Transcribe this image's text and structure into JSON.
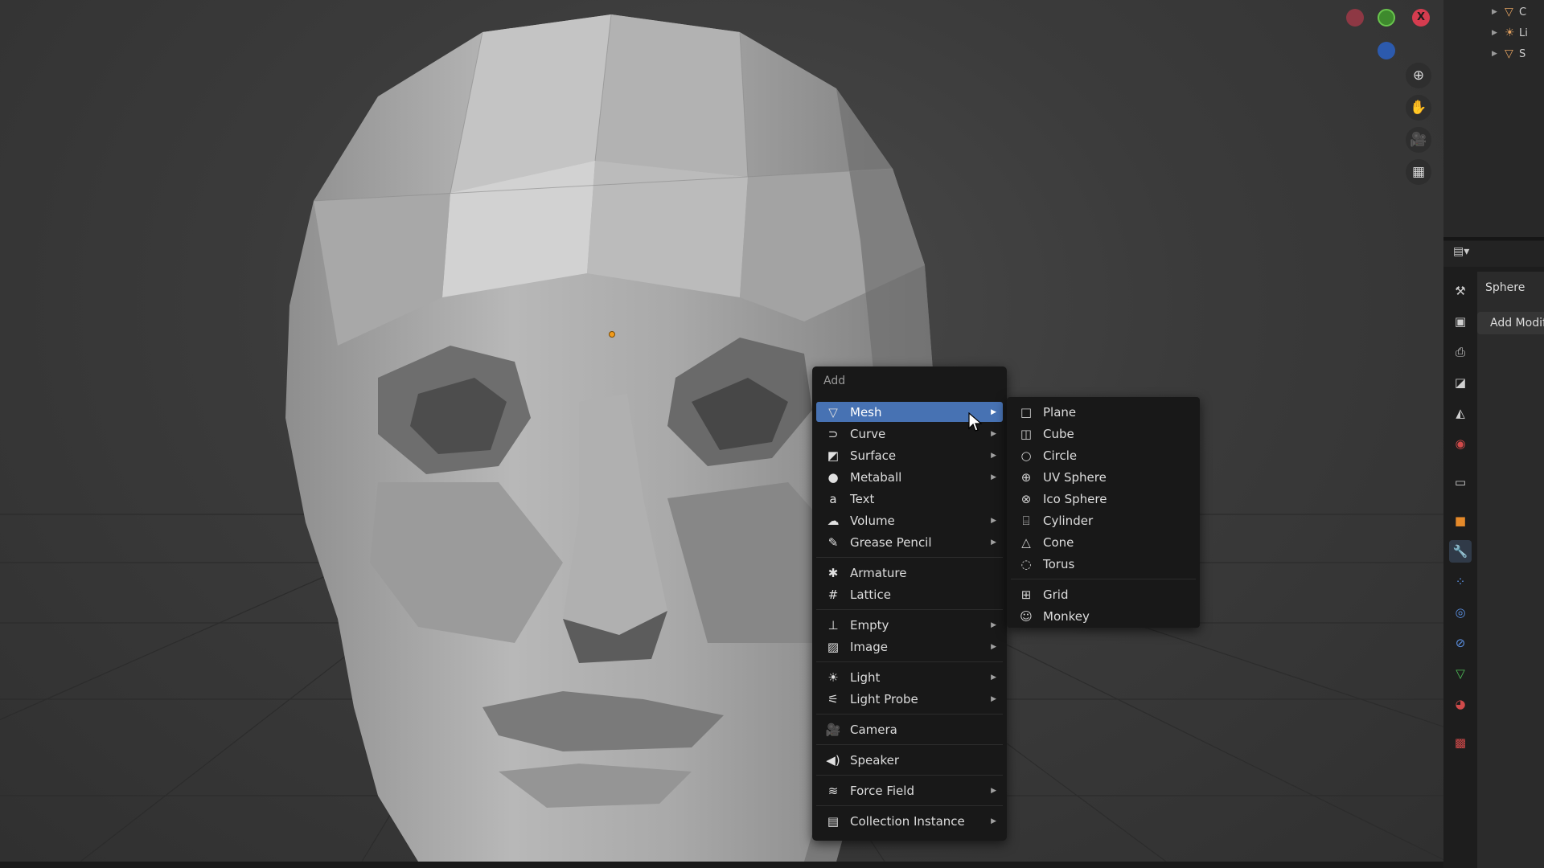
{
  "viewport": {
    "origin_color": "#f29b1b",
    "gizmo": {
      "x_label": "X"
    },
    "tools": [
      {
        "name": "zoom-icon",
        "glyph": "⊕"
      },
      {
        "name": "hand-pan-icon",
        "glyph": "✋"
      },
      {
        "name": "camera-view-icon",
        "glyph": "🎥"
      },
      {
        "name": "perspective-grid-icon",
        "glyph": "▦"
      }
    ]
  },
  "add_menu": {
    "title": "Add",
    "accent": "#4772b3",
    "items": [
      {
        "label": "Mesh",
        "icon": "mesh-icon",
        "glyph": "▽",
        "submenu": true,
        "active": true
      },
      {
        "label": "Curve",
        "icon": "curve-icon",
        "glyph": "⊃",
        "submenu": true
      },
      {
        "label": "Surface",
        "icon": "surface-icon",
        "glyph": "◩",
        "submenu": true
      },
      {
        "label": "Metaball",
        "icon": "metaball-icon",
        "glyph": "●",
        "submenu": true
      },
      {
        "label": "Text",
        "icon": "text-icon",
        "glyph": "a",
        "submenu": false
      },
      {
        "label": "Volume",
        "icon": "volume-icon",
        "glyph": "☁",
        "submenu": true
      },
      {
        "label": "Grease Pencil",
        "icon": "grease-pencil-icon",
        "glyph": "✎",
        "submenu": true
      },
      {
        "label": "Armature",
        "icon": "armature-icon",
        "glyph": "✱",
        "submenu": false
      },
      {
        "label": "Lattice",
        "icon": "lattice-icon",
        "glyph": "#",
        "submenu": false
      },
      {
        "label": "Empty",
        "icon": "empty-icon",
        "glyph": "⊥",
        "submenu": true
      },
      {
        "label": "Image",
        "icon": "image-icon",
        "glyph": "▨",
        "submenu": true
      },
      {
        "label": "Light",
        "icon": "light-icon",
        "glyph": "☀",
        "submenu": true
      },
      {
        "label": "Light Probe",
        "icon": "light-probe-icon",
        "glyph": "⚟",
        "submenu": true
      },
      {
        "label": "Camera",
        "icon": "camera-icon",
        "glyph": "🎥",
        "submenu": false
      },
      {
        "label": "Speaker",
        "icon": "speaker-icon",
        "glyph": "◀)",
        "submenu": false
      },
      {
        "label": "Force Field",
        "icon": "force-field-icon",
        "glyph": "≋",
        "submenu": true
      },
      {
        "label": "Collection Instance",
        "icon": "collection-instance-icon",
        "glyph": "▤",
        "submenu": true
      }
    ]
  },
  "mesh_submenu": {
    "items": [
      {
        "label": "Plane",
        "icon": "plane-icon",
        "glyph": "□"
      },
      {
        "label": "Cube",
        "icon": "cube-icon",
        "glyph": "◫"
      },
      {
        "label": "Circle",
        "icon": "circle-icon",
        "glyph": "○"
      },
      {
        "label": "UV Sphere",
        "icon": "uv-sphere-icon",
        "glyph": "⊕"
      },
      {
        "label": "Ico Sphere",
        "icon": "ico-sphere-icon",
        "glyph": "⊗"
      },
      {
        "label": "Cylinder",
        "icon": "cylinder-icon",
        "glyph": "⌸"
      },
      {
        "label": "Cone",
        "icon": "cone-icon",
        "glyph": "△"
      },
      {
        "label": "Torus",
        "icon": "torus-icon",
        "glyph": "◌"
      },
      {
        "label": "Grid",
        "icon": "grid-icon",
        "glyph": "⊞"
      },
      {
        "label": "Monkey",
        "icon": "monkey-icon",
        "glyph": "☺"
      }
    ]
  },
  "outliner": {
    "rows": [
      {
        "label": "C",
        "icon": "mesh-object-icon",
        "glyph": "▽"
      },
      {
        "label": "Li",
        "icon": "light-object-icon",
        "glyph": "☀"
      },
      {
        "label": "S",
        "icon": "mesh-object-icon",
        "glyph": "▽"
      }
    ]
  },
  "properties": {
    "object_name": "Sphere",
    "add_modifier_label": "Add Modifier",
    "tabs": [
      {
        "name": "tool-tab",
        "glyph": "⚒",
        "color": "#cfcfcf"
      },
      {
        "name": "render-tab",
        "glyph": "▣",
        "color": "#cfcfcf"
      },
      {
        "name": "output-tab",
        "glyph": "⎙",
        "color": "#cfcfcf"
      },
      {
        "name": "view-layer-tab",
        "glyph": "◪",
        "color": "#cfcfcf"
      },
      {
        "name": "scene-tab",
        "glyph": "◭",
        "color": "#cfcfcf"
      },
      {
        "name": "world-tab",
        "glyph": "◉",
        "color": "#d04a4a"
      },
      {
        "name": "collection-tab",
        "glyph": "▭",
        "color": "#cfcfcf"
      },
      {
        "name": "object-tab",
        "glyph": "■",
        "color": "#e58a2a"
      },
      {
        "name": "modifier-tab",
        "glyph": "🔧",
        "color": "#5a8fe0",
        "active": true
      },
      {
        "name": "particles-tab",
        "glyph": "⁘",
        "color": "#5a8fe0"
      },
      {
        "name": "physics-tab",
        "glyph": "◎",
        "color": "#5a8fe0"
      },
      {
        "name": "constraints-tab",
        "glyph": "⊘",
        "color": "#5a8fe0"
      },
      {
        "name": "data-tab",
        "glyph": "▽",
        "color": "#4fbf58"
      },
      {
        "name": "material-tab",
        "glyph": "◕",
        "color": "#d04a4a"
      },
      {
        "name": "texture-tab",
        "glyph": "▩",
        "color": "#d04a4a"
      }
    ]
  }
}
